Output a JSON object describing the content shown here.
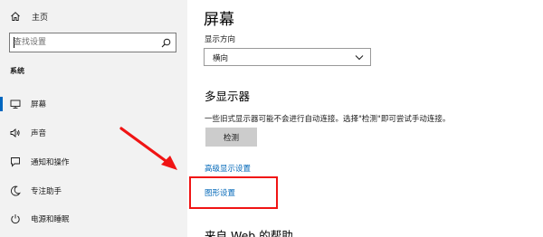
{
  "sidebar": {
    "home_label": "主页",
    "search_placeholder": "查找设置",
    "section_label": "系统",
    "items": [
      {
        "label": "屏幕",
        "icon": "monitor-icon",
        "active": true
      },
      {
        "label": "声音",
        "icon": "speaker-icon"
      },
      {
        "label": "通知和操作",
        "icon": "notification-icon"
      },
      {
        "label": "专注助手",
        "icon": "moon-icon"
      },
      {
        "label": "电源和睡眠",
        "icon": "power-icon"
      }
    ]
  },
  "main": {
    "title": "屏幕",
    "orientation_label": "显示方向",
    "orientation_value": "横向",
    "multi_display_heading": "多显示器",
    "multi_display_desc": "一些旧式显示器可能不会进行自动连接。选择\"检测\"即可尝试手动连接。",
    "detect_button": "检测",
    "advanced_link": "高级显示设置",
    "graphics_link": "图形设置",
    "next_heading_cut": "来自 Web 的帮助"
  },
  "colors": {
    "accent": "#0067c0",
    "link": "#0067b8",
    "annotation": "#f01414",
    "sidebar_bg": "#f2f2f2",
    "button_bg": "#cccccc"
  }
}
